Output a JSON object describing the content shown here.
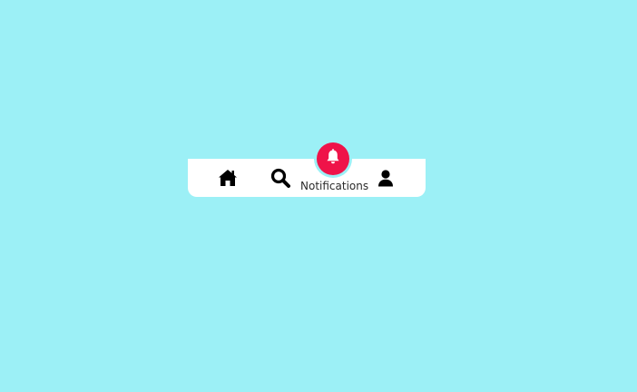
{
  "background_color": "#9cf0f6",
  "navbar": {
    "items": [
      {
        "id": "home",
        "icon": "home-icon",
        "active": false
      },
      {
        "id": "search",
        "icon": "search-icon",
        "active": false
      },
      {
        "id": "notifications",
        "icon": "bell-icon",
        "label": "Notifications",
        "active": true
      },
      {
        "id": "profile",
        "icon": "user-icon",
        "active": false
      }
    ],
    "active_color": "#ef1349",
    "icon_color": "#000000"
  }
}
